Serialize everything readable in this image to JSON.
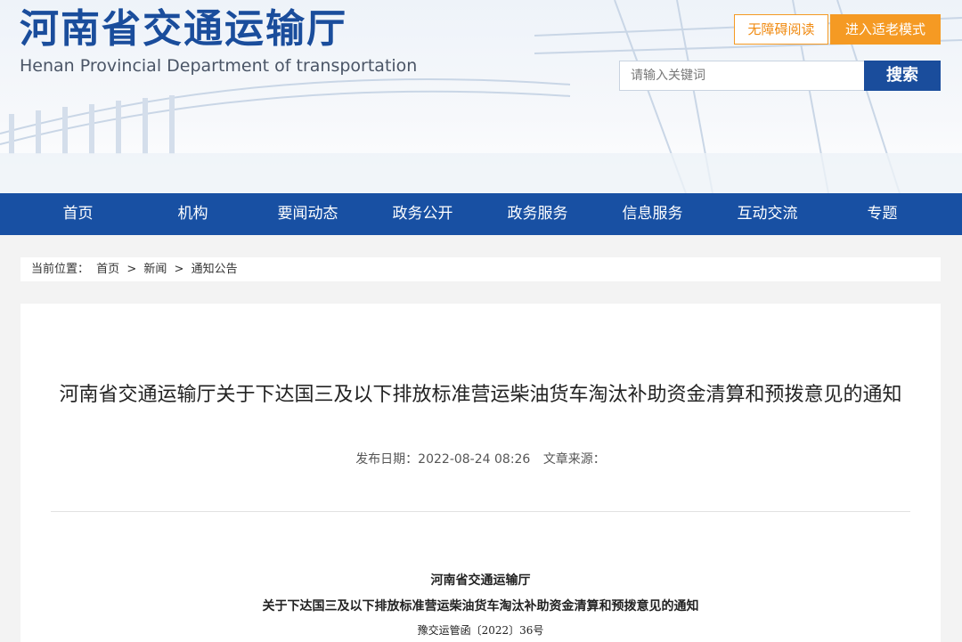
{
  "header": {
    "title": "河南省交通运输厅",
    "subtitle": "Henan Provincial Department of transportation",
    "accessibility_label": "无障碍阅读",
    "elder_mode_label": "进入适老模式",
    "search_placeholder": "请输入关键词",
    "search_label": "搜索"
  },
  "nav": {
    "items": [
      "首页",
      "机构",
      "要闻动态",
      "政务公开",
      "政务服务",
      "信息服务",
      "互动交流",
      "专题"
    ]
  },
  "breadcrumb": {
    "prefix": "当前位置：",
    "items": [
      "首页",
      "新闻",
      "通知公告"
    ],
    "separator": ">"
  },
  "article": {
    "title": "河南省交通运输厅关于下达国三及以下排放标准营运柴油货车淘汰补助资金清算和预拨意见的通知",
    "date_label": "发布日期：2022-08-24 08:26",
    "source_label": "文章来源：",
    "doc_issuer": "河南省交通运输厅",
    "doc_title": "关于下达国三及以下排放标准营运柴油货车淘汰补助资金清算和预拨意见的通知",
    "doc_number": "豫交运管函〔2022〕36号"
  },
  "colors": {
    "brand_blue": "#1850a3",
    "accent_orange": "#f59a23"
  }
}
